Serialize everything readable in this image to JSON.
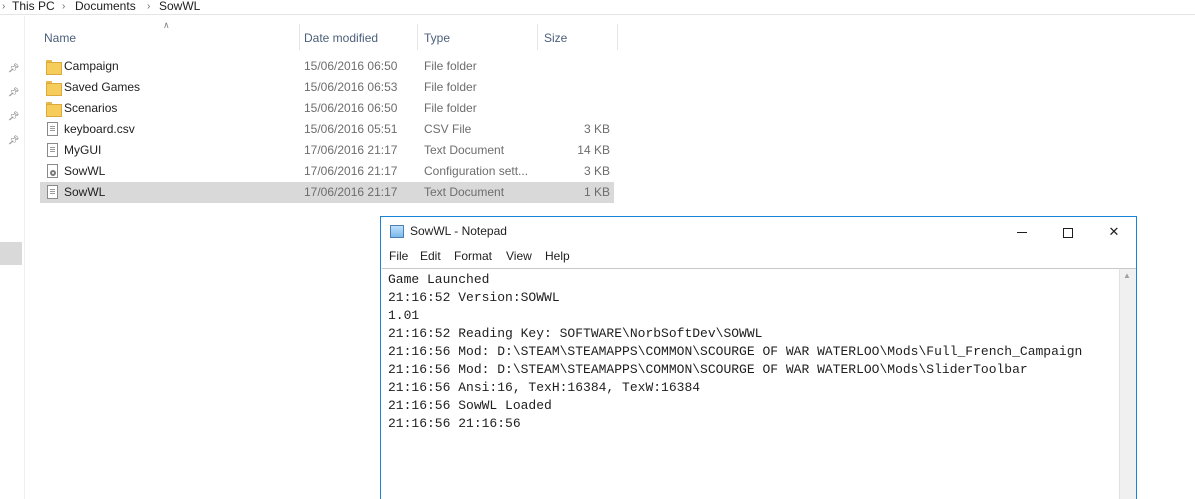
{
  "breadcrumb": {
    "items": [
      "This PC",
      "Documents",
      "SowWL"
    ],
    "separator": "›"
  },
  "columns": {
    "name": "Name",
    "date_modified": "Date modified",
    "type": "Type",
    "size": "Size"
  },
  "files": [
    {
      "name": "Campaign",
      "date": "15/06/2016 06:50",
      "type": "File folder",
      "size": "",
      "icon": "folder-icon"
    },
    {
      "name": "Saved Games",
      "date": "15/06/2016 06:53",
      "type": "File folder",
      "size": "",
      "icon": "folder-icon"
    },
    {
      "name": "Scenarios",
      "date": "15/06/2016 06:50",
      "type": "File folder",
      "size": "",
      "icon": "folder-icon"
    },
    {
      "name": "keyboard.csv",
      "date": "15/06/2016 05:51",
      "type": "CSV File",
      "size": "3 KB",
      "icon": "csv-file-icon"
    },
    {
      "name": "MyGUI",
      "date": "17/06/2016 21:17",
      "type": "Text Document",
      "size": "14 KB",
      "icon": "text-file-icon"
    },
    {
      "name": "SowWL",
      "date": "17/06/2016 21:17",
      "type": "Configuration sett...",
      "size": "3 KB",
      "icon": "config-file-icon"
    },
    {
      "name": "SowWL",
      "date": "17/06/2016 21:17",
      "type": "Text Document",
      "size": "1 KB",
      "icon": "text-file-icon",
      "selected": true
    }
  ],
  "notepad": {
    "title": "SowWL - Notepad",
    "menu": [
      "File",
      "Edit",
      "Format",
      "View",
      "Help"
    ],
    "lines": [
      "Game Launched",
      "21:16:52 Version:SOWWL",
      "1.01",
      "21:16:52 Reading Key: SOFTWARE\\NorbSoftDev\\SOWWL",
      "21:16:56 Mod: D:\\STEAM\\STEAMAPPS\\COMMON\\SCOURGE OF WAR WATERLOO\\Mods\\Full_French_Campaign",
      "21:16:56 Mod: D:\\STEAM\\STEAMAPPS\\COMMON\\SCOURGE OF WAR WATERLOO\\Mods\\SliderToolbar",
      "21:16:56 Ansi:16, TexH:16384, TexW:16384",
      "21:16:56 SowWL Loaded",
      "21:16:56 21:16:56"
    ],
    "close_glyph": "✕"
  },
  "colors": {
    "accent": "#1883d7",
    "selection": "#d9d9d9",
    "folder": "#f6cc5a"
  }
}
